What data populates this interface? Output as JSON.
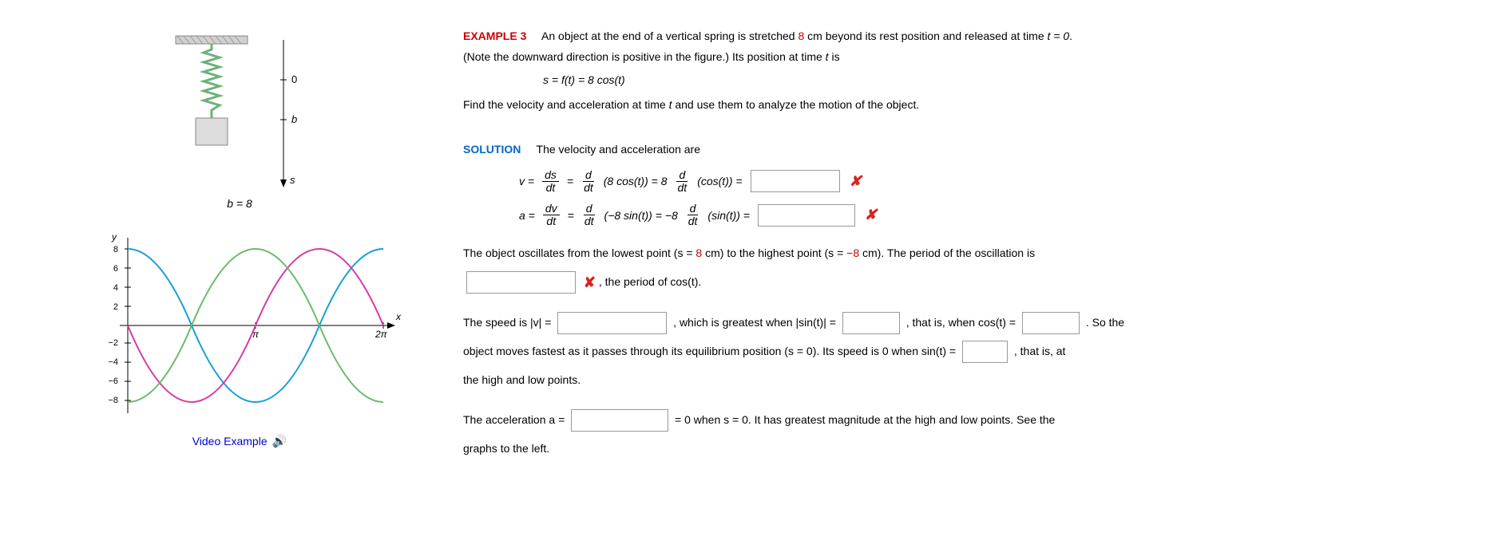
{
  "example": {
    "label": "EXAMPLE 3",
    "intro_prefix": "An object at the end of a vertical spring is stretched ",
    "stretch_cm": "8",
    "intro_suffix_1": " cm beyond its rest position and released at time  ",
    "t_eq_0": "t = 0",
    "intro_line2": "(Note the downward direction is positive in the figure.) Its position at time ",
    "t_is": "t",
    "is_word": " is",
    "s_eq": "s = f(t) = 8 cos(t)",
    "find_line": "Find the velocity and acceleration at time ",
    "find_t": "t",
    "find_rest": " and use them to analyze the motion of the object."
  },
  "solution": {
    "label": "SOLUTION",
    "intro": "The velocity and acceleration are",
    "v_lhs": "v =",
    "ds": "ds",
    "dt": "dt",
    "eq": "=",
    "d": "d",
    "v_mid1": "(8 cos(t)) = 8",
    "v_mid2": "(cos(t)) =",
    "a_lhs": "a =",
    "dv": "dv",
    "a_mid1": "(−8 sin(t)) = −8",
    "a_mid2": "(sin(t)) =",
    "osc_1": "The object oscillates from the lowest point  (s = ",
    "osc_low": "8",
    "osc_2": " cm)  to the highest point  (s = ",
    "osc_high": "−8",
    "osc_3": " cm).  The period of the oscillation is",
    "period_tail": ",  the period of  cos(t).",
    "speed_1": "The speed is  |v| =",
    "speed_2": ",  which is greatest when  |sin(t)| =",
    "speed_3": ",  that is, when  cos(t) =",
    "speed_4": ".  So the",
    "speed_line2_a": "object moves fastest as it passes through its equilibrium position  (s = 0).  Its speed is 0 when  sin(t) =",
    "speed_line2_b": ",  that is, at",
    "speed_line3": "the high and low points.",
    "accel_1": "The acceleration  a =",
    "accel_2": "= 0  when  s = 0.  It has greatest magnitude at the high and low points. See the",
    "accel_3": "graphs to the left."
  },
  "figure": {
    "b_eq": "b = 8",
    "axis0": "0",
    "axisb": "b",
    "axiss": "s",
    "y": "y",
    "x": "x",
    "ticks_pos": [
      "8",
      "6",
      "4",
      "2"
    ],
    "ticks_neg": [
      "−2",
      "−4",
      "−6",
      "−8"
    ],
    "pi": "π",
    "two_pi": "2π"
  },
  "video_label": "Video Example",
  "icons": {
    "wrong": "✘",
    "sound": "🔊"
  }
}
